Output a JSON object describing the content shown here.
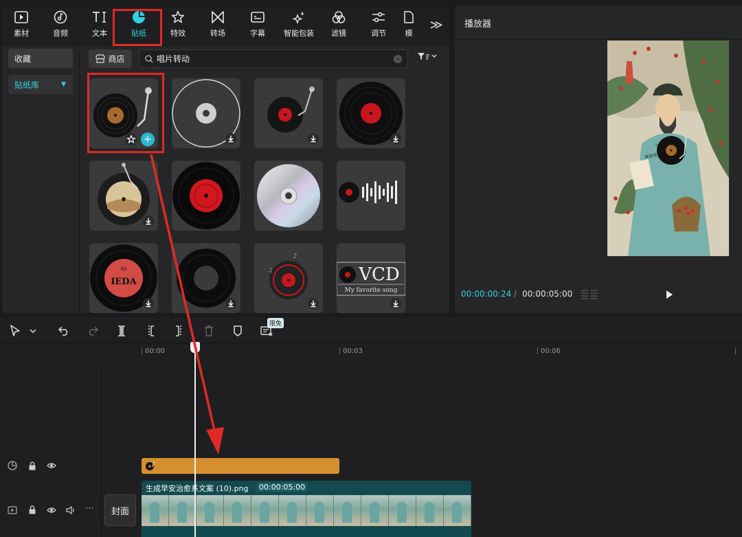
{
  "nav": {
    "items": [
      {
        "label": "素材",
        "icon": "media-icon"
      },
      {
        "label": "音频",
        "icon": "audio-icon"
      },
      {
        "label": "文本",
        "icon": "text-icon"
      },
      {
        "label": "贴纸",
        "icon": "sticker-icon",
        "active": true
      },
      {
        "label": "特效",
        "icon": "effects-icon"
      },
      {
        "label": "转场",
        "icon": "transition-icon"
      },
      {
        "label": "字幕",
        "icon": "subtitle-icon"
      },
      {
        "label": "智能包装",
        "icon": "smart-package-icon"
      },
      {
        "label": "滤镜",
        "icon": "filter-icon"
      },
      {
        "label": "调节",
        "icon": "adjust-icon"
      },
      {
        "label": "模",
        "icon": "template-icon"
      }
    ],
    "more": "≫"
  },
  "sidebar": {
    "items": [
      {
        "label": "收藏"
      },
      {
        "label": "贴纸库",
        "active": true
      }
    ]
  },
  "library": {
    "store_label": "商店",
    "search_value": "唱片转动",
    "filter_label": "⊽",
    "stickers": [
      {
        "name": "turntable-sticker"
      },
      {
        "name": "cd-outline-sticker"
      },
      {
        "name": "red-turntable-sticker"
      },
      {
        "name": "vinyl-red-label-sticker"
      },
      {
        "name": "vintage-turntable-sticker"
      },
      {
        "name": "red-vinyl-sticker"
      },
      {
        "name": "silver-cd-sticker"
      },
      {
        "name": "vinyl-soundwave-sticker"
      },
      {
        "name": "ieda-vinyl-sticker"
      },
      {
        "name": "black-vinyl-sticker"
      },
      {
        "name": "music-disc-sticker"
      },
      {
        "name": "vcd-sticker"
      }
    ],
    "ieda_text": "IEDA",
    "ieda_top": "80",
    "vcd_title": "VCD",
    "vcd_subtitle": "My favorite song"
  },
  "player": {
    "title": "播放器",
    "time_current": "00:00:00:24",
    "time_separator": "/",
    "time_total": "00:00:05:00",
    "poem_text": "高枝戏"
  },
  "timeline": {
    "free_badge": "限免",
    "ticks": [
      "00:00",
      "00:03",
      "00:06"
    ],
    "clip_name": "生成早安治愈系文案 (10).png",
    "clip_duration": "00:00:05:00",
    "cover_label": "封面"
  },
  "colors": {
    "accent": "#2fd2e0",
    "highlight": "#e12a25",
    "sticker_clip": "#d5902d",
    "video_clip": "#134a4f"
  }
}
